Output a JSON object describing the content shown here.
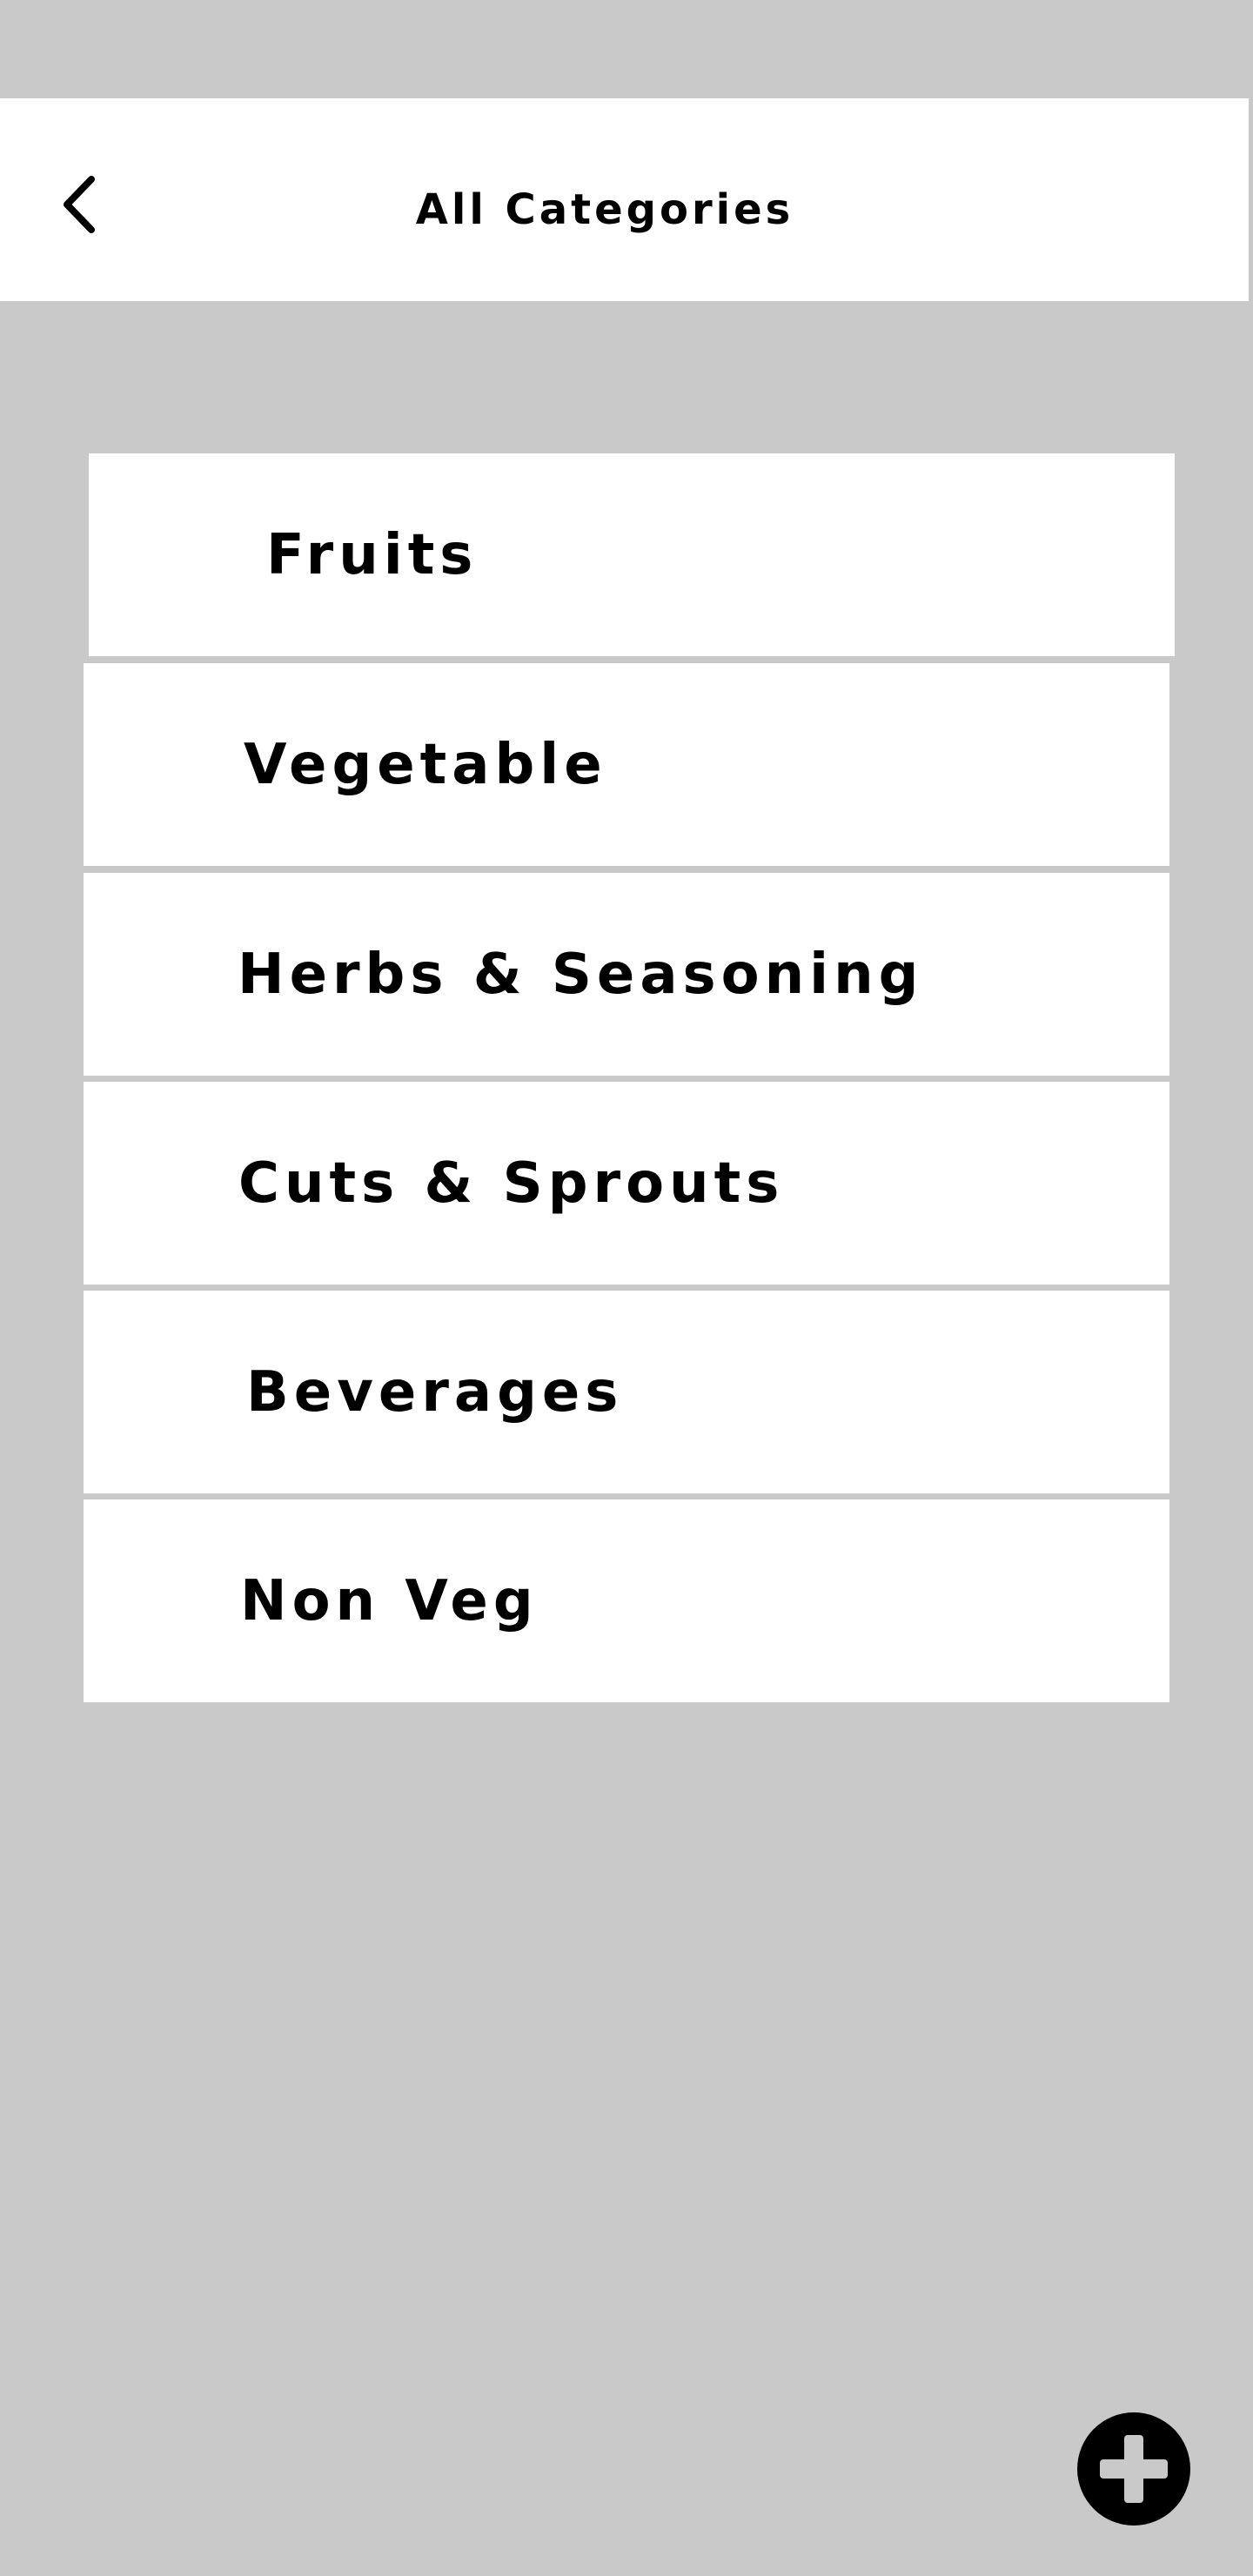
{
  "header": {
    "title": "All Categories",
    "back_icon": "chevron-left-icon"
  },
  "categories": [
    {
      "label": "Fruits"
    },
    {
      "label": "Vegetable"
    },
    {
      "label": "Herbs & Seasoning"
    },
    {
      "label": "Cuts & Sprouts"
    },
    {
      "label": "Beverages"
    },
    {
      "label": "Non Veg"
    }
  ],
  "fab": {
    "icon": "plus-icon"
  },
  "colors": {
    "background": "#c9c9c9",
    "card": "#ffffff",
    "text": "#000000"
  }
}
